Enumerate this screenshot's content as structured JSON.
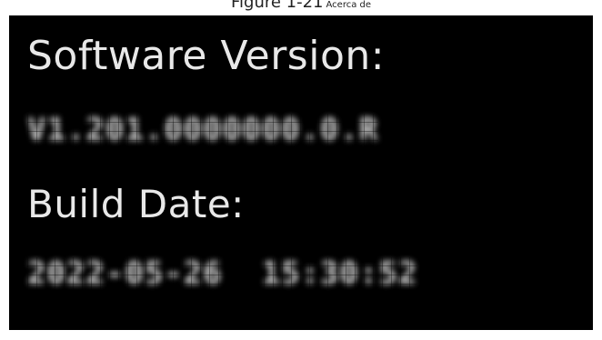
{
  "caption": {
    "figure_title": "Figure 1-21",
    "figure_subtitle": "Acerca de"
  },
  "screen": {
    "software_version_label": "Software Version:",
    "software_version_value": "V1.201.0000000.0.R",
    "build_date_label": "Build Date:",
    "build_date_value": "2022-05-26  15:30:52"
  },
  "colors": {
    "screen_background": "#000000",
    "text": "#e8e8e8",
    "page_background": "#ffffff"
  }
}
